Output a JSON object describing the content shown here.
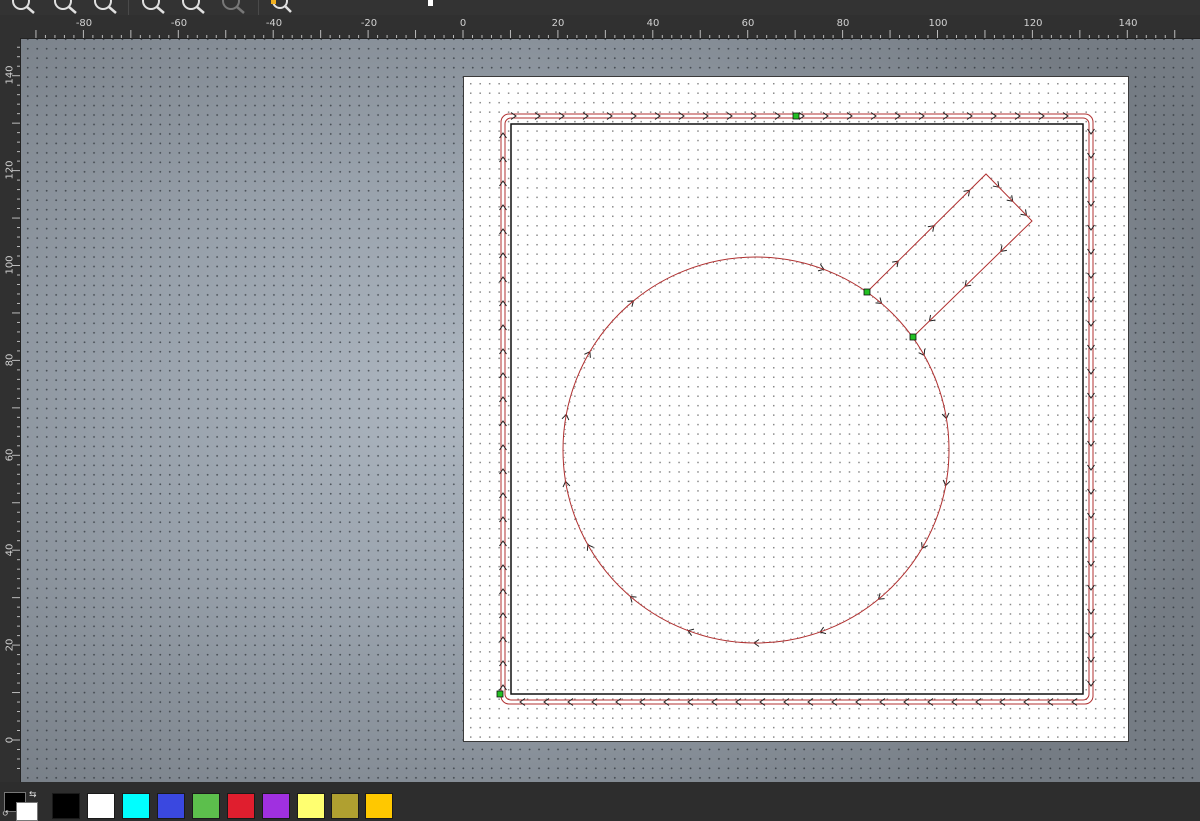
{
  "toolbar": {
    "buttons": [
      {
        "name": "zoom-fit-icon"
      },
      {
        "name": "zoom-in-icon"
      },
      {
        "name": "zoom-out-icon"
      },
      {
        "name": "zoom-selection-icon"
      },
      {
        "name": "zoom-previous-icon"
      },
      {
        "name": "zoom-disabled-icon"
      },
      {
        "name": "zoom-page-icon"
      }
    ]
  },
  "rulers": {
    "horizontal": [
      "-80",
      "-60",
      "-40",
      "-20",
      "0",
      "20",
      "40",
      "60",
      "80",
      "100",
      "120",
      "140"
    ],
    "vertical": [
      "140",
      "120",
      "100",
      "80",
      "60",
      "40",
      "20",
      "0"
    ]
  },
  "design": {
    "outer_frame": "rounded-rectangle cut path",
    "circle_path": "circle with tab cut path",
    "path_color": "#b03030",
    "start_marker_color": "#22c022"
  },
  "palette": {
    "current_foreground": "#000000",
    "current_background": "#ffffff",
    "swap_icon": "swap-colors-icon",
    "reset_icon": "reset-colors-icon",
    "colors": [
      "#000000",
      "#ffffff",
      "#00ffff",
      "#3a48e0",
      "#5cbf4c",
      "#e01e2e",
      "#a030e0",
      "#ffff70",
      "#b0a030",
      "#ffc800"
    ]
  }
}
